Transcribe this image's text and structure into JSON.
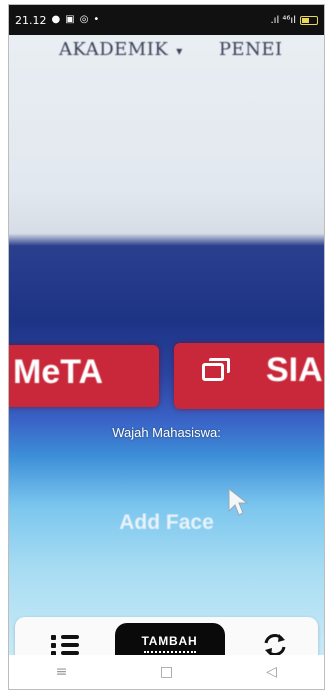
{
  "status_bar": {
    "time": "21.12",
    "left_icons": [
      "facebook-icon",
      "gallery-icon",
      "instagram-icon"
    ],
    "dot": "•",
    "signal_text": ".ıl ⁴⁶ıl"
  },
  "camera_view": {
    "top_menu": {
      "akademik": "AKADEMIK",
      "caret": "▾",
      "penelitian_partial": "PENEI"
    },
    "tiles": {
      "meta": "MeTA",
      "sia": "SIA"
    },
    "face_label": "Wajah Mahasiswa:",
    "add_face": "Add Face"
  },
  "toolbar": {
    "list_icon": "list-icon",
    "tambah_label": "TAMBAH",
    "refresh_icon": "refresh-icon"
  },
  "navbar": {
    "recent": "≡",
    "home": "□",
    "back": "◁"
  },
  "colors": {
    "tile_red": "#c8283a",
    "button_black": "#0a0a0a",
    "status_bar": "#111111"
  }
}
